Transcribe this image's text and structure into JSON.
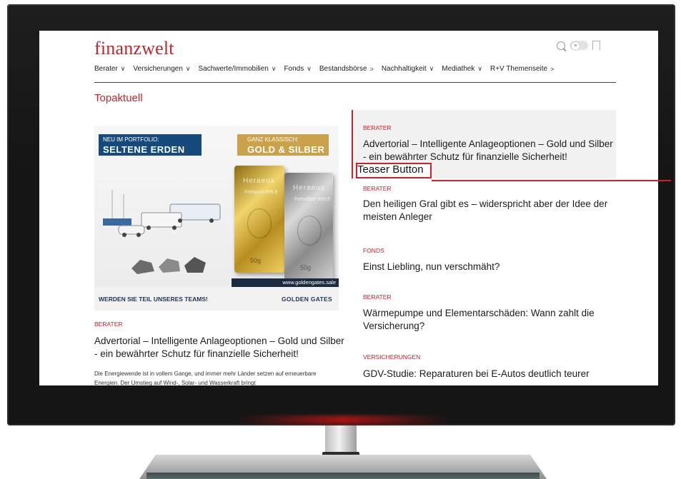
{
  "site": {
    "logo": "finanzwelt"
  },
  "header_icons": {
    "toggle_symbol": "☀"
  },
  "nav": [
    {
      "label": "Berater",
      "chevron": "∨"
    },
    {
      "label": "Versicherungen",
      "chevron": "∨"
    },
    {
      "label": "Sachwerte/Immobilien",
      "chevron": "∨"
    },
    {
      "label": "Fonds",
      "chevron": "∨"
    },
    {
      "label": "Bestandsbörse",
      "chevron": ">"
    },
    {
      "label": "Nachhaltigkeit",
      "chevron": "∨"
    },
    {
      "label": "Mediathek",
      "chevron": "∨"
    },
    {
      "label": "R+V Themenseite",
      "chevron": ">"
    }
  ],
  "section_title": "Topaktuell",
  "feature_image": {
    "badge_left_line1": "NEU IM PORTFOLIO:",
    "badge_left_line2": "SELTENE ERDEN",
    "badge_right_line1": "GANZ KLASSISCH:",
    "badge_right_line2": "GOLD & SILBER",
    "gold_brand": "Heraeus",
    "gold_sub": "Feingold 999,9",
    "gold_weight": "50g",
    "silver_brand": "Heraeus",
    "silver_sub": "Feinsilber 999,9",
    "silver_weight": "50g",
    "url": "www.goldengates.sale",
    "footer_left": "WERDEN SIE TEIL UNSERES TEAMS!",
    "footer_right": "GOLDEN GATES"
  },
  "featured_article": {
    "category": "BERATER",
    "title": "Advertorial – Intelligente Anlageoptionen – Gold und Silber - ein bewährter Schutz für finanzielle Sicherheit!",
    "body": "Die Energiewende ist in vollem Gange, und immer mehr Länder setzen auf erneuerbare Energien. Der Umstieg auf Wind-, Solar- und Wasserkraft bringt"
  },
  "side_articles": [
    {
      "category": "BERATER",
      "title": "Advertorial – Intelligente Anlageoptionen – Gold und Silber - ein bewährter Schutz für finanzielle Sicherheit!"
    },
    {
      "category": "BERATER",
      "title": "Den heiligen Gral gibt es – widerspricht aber der Idee der meisten Anleger"
    },
    {
      "category": "FONDS",
      "title": "Einst Liebling, nun verschmäht?"
    },
    {
      "category": "BERATER",
      "title": "Wärmepumpe und Elementarschäden: Wann zahlt die Versicherung?"
    },
    {
      "category": "VERSICHERUNGEN",
      "title": "GDV-Studie: Reparaturen bei E-Autos deutlich teurer"
    }
  ],
  "annotation": {
    "label": "Teaser Button"
  },
  "colors": {
    "brand_red": "#c0272d",
    "annotation_red": "#d0202a",
    "monitor_bezel": "#151515"
  }
}
